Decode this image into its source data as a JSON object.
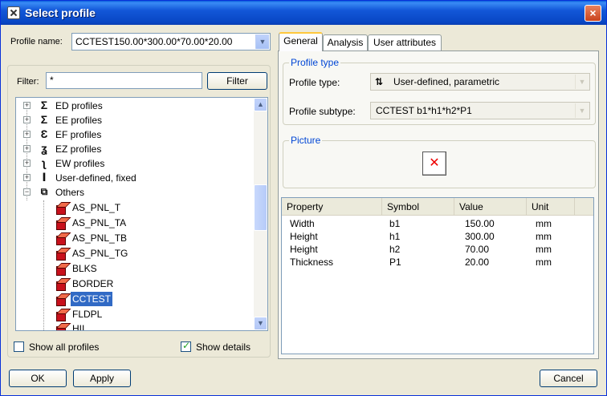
{
  "window": {
    "title": "Select profile",
    "close": "×"
  },
  "profile_name": {
    "label": "Profile name:",
    "value": "CCTEST150.00*300.00*70.00*20.00"
  },
  "filter": {
    "label": "Filter:",
    "value": "*",
    "button": "Filter"
  },
  "tree": {
    "groups": [
      {
        "label": "ED profiles",
        "icon": "ed-profile-icon"
      },
      {
        "label": "EE profiles",
        "icon": "ee-profile-icon"
      },
      {
        "label": "EF profiles",
        "icon": "ef-profile-icon"
      },
      {
        "label": "EZ profiles",
        "icon": "ez-profile-icon"
      },
      {
        "label": "EW profiles",
        "icon": "ew-profile-icon"
      },
      {
        "label": "User-defined, fixed",
        "icon": "i-beam-icon"
      },
      {
        "label": "Others",
        "icon": "others-folder-icon"
      }
    ],
    "leaves": [
      "AS_PNL_T",
      "AS_PNL_TA",
      "AS_PNL_TB",
      "AS_PNL_TG",
      "BLKS",
      "BORDER",
      "CCTEST",
      "FLDPL",
      "HII"
    ],
    "selected": "CCTEST"
  },
  "options": {
    "show_all": "Show all profiles",
    "show_all_checked": false,
    "show_details": "Show details",
    "show_details_checked": true
  },
  "tabs": [
    "General",
    "Analysis",
    "User attributes"
  ],
  "active_tab": "General",
  "profile_type_group": {
    "title": "Profile type",
    "type_label": "Profile type:",
    "type_value": "User-defined, parametric",
    "subtype_label": "Profile subtype:",
    "subtype_value": "CCTEST b1*h1*h2*P1"
  },
  "picture_group": {
    "title": "Picture",
    "icon": "broken-image-icon"
  },
  "properties": {
    "columns": [
      "Property",
      "Symbol",
      "Value",
      "Unit"
    ],
    "rows": [
      {
        "property": "Width",
        "symbol": "b1",
        "value": "150.00",
        "unit": "mm"
      },
      {
        "property": "Height",
        "symbol": "h1",
        "value": "300.00",
        "unit": "mm"
      },
      {
        "property": "Height",
        "symbol": "h2",
        "value": "70.00",
        "unit": "mm"
      },
      {
        "property": "Thickness",
        "symbol": "P1",
        "value": "20.00",
        "unit": "mm"
      }
    ]
  },
  "buttons": {
    "ok": "OK",
    "apply": "Apply",
    "cancel": "Cancel"
  },
  "colors": {
    "title_bar": "#0a5fdc",
    "selection": "#316ac5",
    "group_title": "#0046d5"
  }
}
